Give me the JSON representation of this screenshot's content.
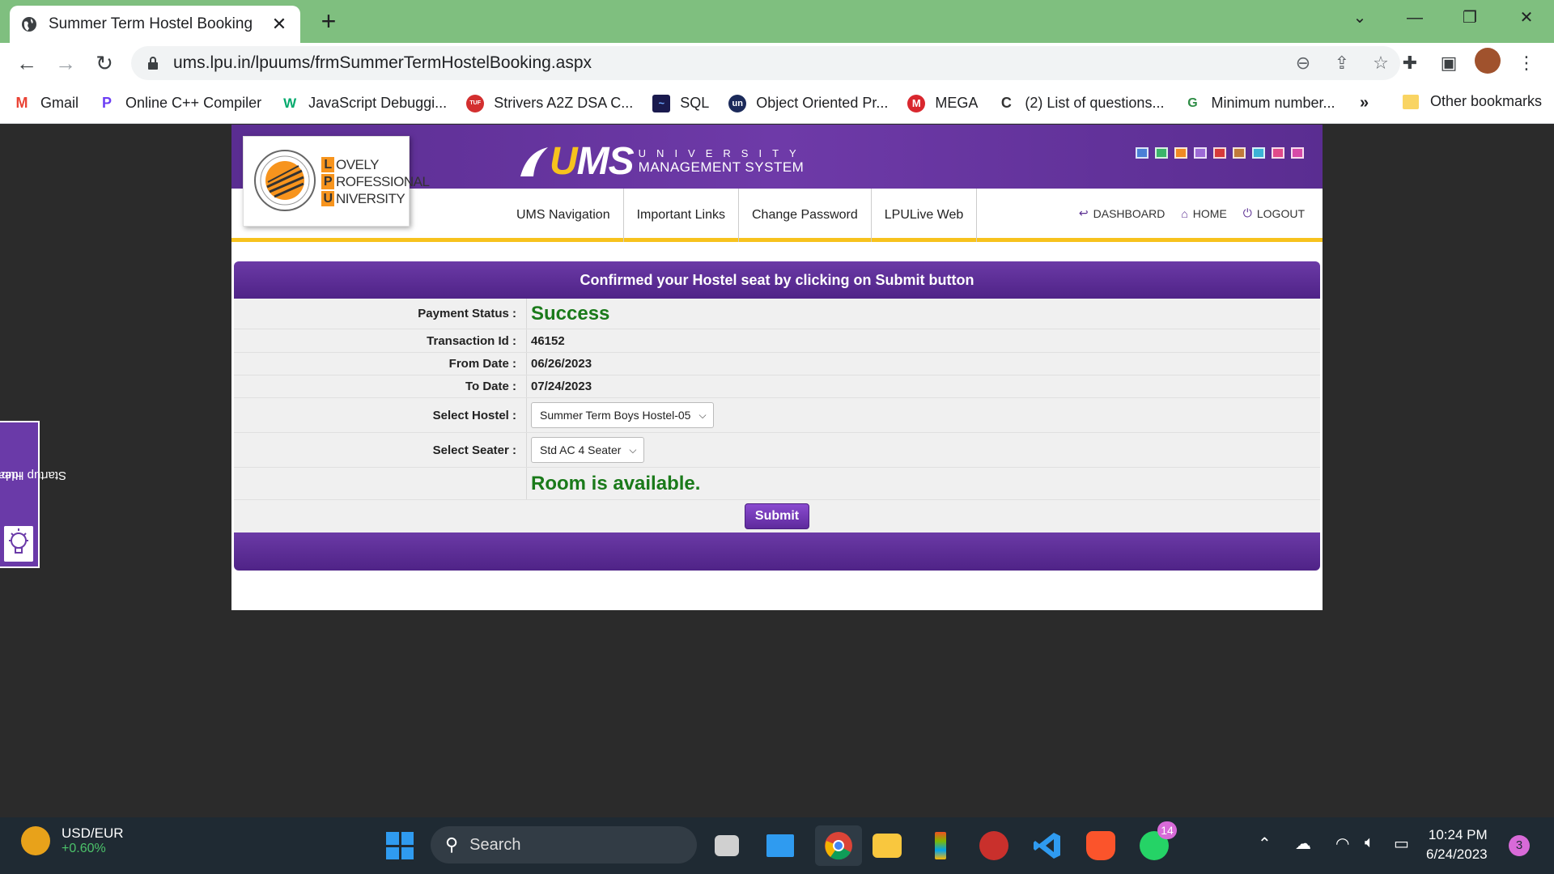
{
  "browser": {
    "tab_title": "Summer Term Hostel Booking",
    "tab_close": "✕",
    "new_tab": "+",
    "url": "ums.lpu.in/lpuums/frmSummerTermHostelBooking.aspx",
    "bookmarks": [
      {
        "label": "Gmail",
        "icon": "gmail-icon",
        "color": "#ea4335",
        "glyph": "M"
      },
      {
        "label": "Online C++ Compiler",
        "icon": "programiz-icon",
        "color": "#6c3ef4",
        "glyph": "P"
      },
      {
        "label": "JavaScript Debuggi...",
        "icon": "w3schools-icon",
        "color": "#04aa6d",
        "glyph": "W"
      },
      {
        "label": "Strivers A2Z DSA C...",
        "icon": "tuf-icon",
        "color": "#d32f2f",
        "glyph": "TUF"
      },
      {
        "label": "SQL",
        "icon": "sql-icon",
        "color": "#1a1a4e",
        "glyph": "~"
      },
      {
        "label": "Object Oriented Pr...",
        "icon": "unacademy-icon",
        "color": "#1b2a5a",
        "glyph": "un"
      },
      {
        "label": "MEGA",
        "icon": "mega-icon",
        "color": "#d9272e",
        "glyph": "M"
      },
      {
        "label": "(2) List of questions...",
        "icon": "codeforces-icon",
        "color": "#f5c518",
        "glyph": "C"
      },
      {
        "label": "Minimum number...",
        "icon": "geeksforgeeks-icon",
        "color": "#2f8d46",
        "glyph": "G"
      }
    ],
    "bookmarks_more": "»",
    "other_bookmarks": "Other bookmarks"
  },
  "lpu_logo": {
    "lines": [
      {
        "initial": "L",
        "rest": "OVELY"
      },
      {
        "initial": "P",
        "rest": "ROFESSIONAL"
      },
      {
        "initial": "U",
        "rest": "NIVERSITY"
      }
    ]
  },
  "ums_brand": {
    "logo_u": "U",
    "logo_rest": "MS",
    "line1": "UNIVERSITY",
    "line2": "MANAGEMENT SYSTEM"
  },
  "theme_swatches": [
    "#4a7fd6",
    "#3bb36a",
    "#f08a24",
    "#9c6ad6",
    "#d63a3a",
    "#c07a3a",
    "#3bb3d6",
    "#e04a8a",
    "#d64aa8"
  ],
  "menu": [
    "UMS Navigation",
    "Important Links",
    "Change Password",
    "LPULive Web"
  ],
  "right_links": [
    {
      "label": "DASHBOARD",
      "icon": "dashboard-icon",
      "glyph": "↩"
    },
    {
      "label": "HOME",
      "icon": "home-icon",
      "glyph": "⌂"
    },
    {
      "label": "LOGOUT",
      "icon": "power-icon",
      "glyph": "⏻"
    }
  ],
  "form": {
    "heading": "Confirmed your Hostel seat by clicking on Submit button",
    "payment_status_label": "Payment Status :",
    "payment_status_value": "Success",
    "transaction_label": "Transaction Id :",
    "transaction_value": "46152",
    "from_label": "From Date :",
    "from_value": "06/26/2023",
    "to_label": "To Date :",
    "to_value": "07/24/2023",
    "hostel_label": "Select Hostel :",
    "hostel_value": "Summer Term Boys Hostel-05",
    "seater_label": "Select Seater :",
    "seater_value": "Std AC 4 Seater",
    "availability": "Room is available.",
    "submit_label": "Submit"
  },
  "startup_tab": {
    "line1": "Idea /",
    "line2": "Startup Hub"
  },
  "taskbar": {
    "widget_title": "USD/EUR",
    "widget_value": "+0.60%",
    "search_label": "Search",
    "whatsapp_badge": "14",
    "time": "10:24 PM",
    "date": "6/24/2023",
    "notifications": "3"
  }
}
